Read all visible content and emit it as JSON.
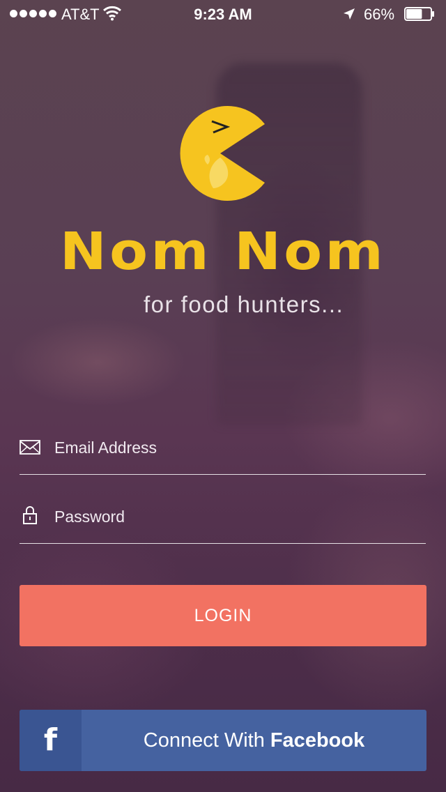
{
  "status_bar": {
    "carrier": "AT&T",
    "time": "9:23 AM",
    "battery_percent": "66%",
    "battery_level": 0.66
  },
  "brand": {
    "title": "Nom Nom",
    "tagline": "for food hunters...",
    "logo_icon": "pacman-eating-icon",
    "logo_color": "#f6c41f"
  },
  "form": {
    "email_placeholder": "Email Address",
    "email_value": "",
    "password_placeholder": "Password",
    "password_value": ""
  },
  "actions": {
    "login_label": "LOGIN",
    "login_color": "#f27262",
    "facebook_prefix": "Connect With",
    "facebook_brand": "Facebook",
    "facebook_icon": "f",
    "facebook_color": "#4562a0"
  }
}
